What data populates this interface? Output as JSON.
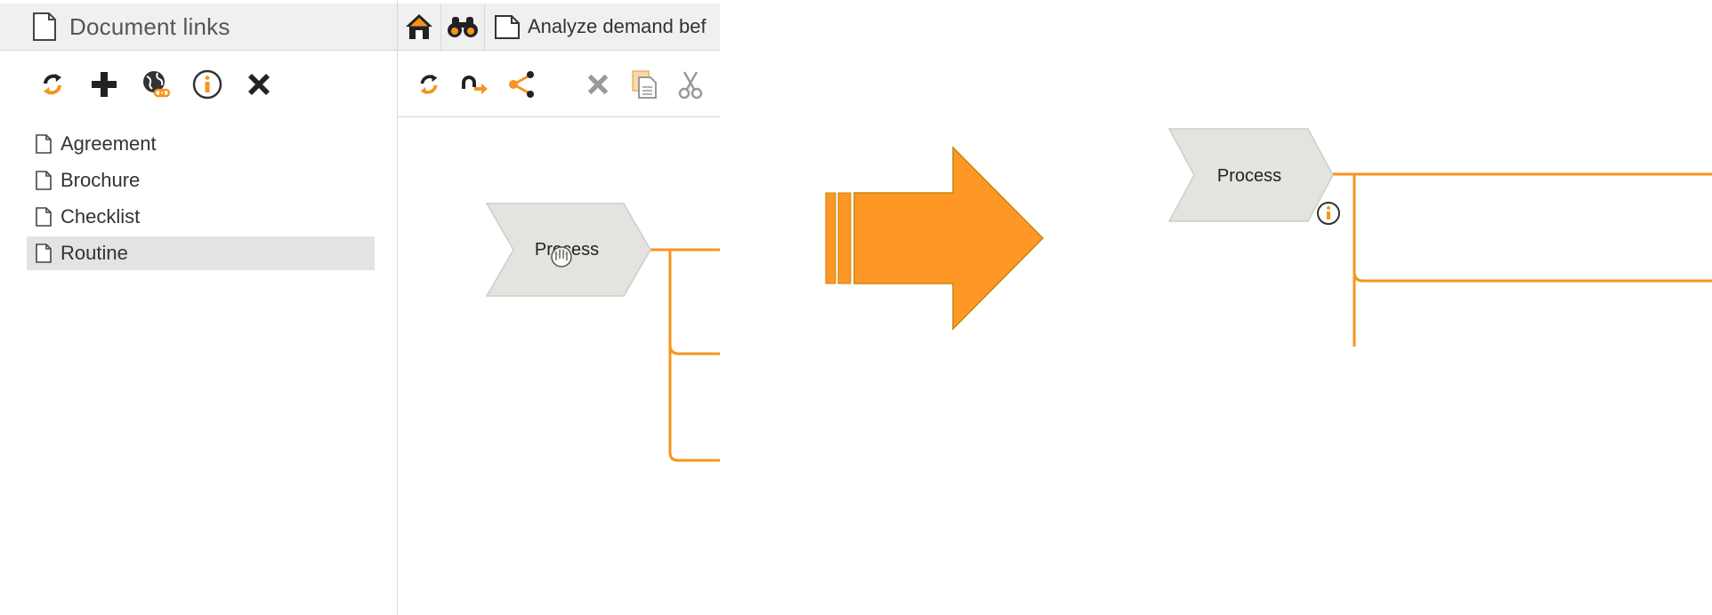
{
  "left_panel": {
    "title": "Document links",
    "toolbar": [
      "refresh-icon",
      "add-icon",
      "web-link-icon",
      "info-icon",
      "delete-icon"
    ],
    "documents": [
      {
        "label": "Agreement",
        "selected": false
      },
      {
        "label": "Brochure",
        "selected": false
      },
      {
        "label": "Checklist",
        "selected": false
      },
      {
        "label": "Routine",
        "selected": true
      }
    ]
  },
  "editor": {
    "tab_label": "Analyze demand bef",
    "toolbar": [
      "refresh-icon",
      "redo-icon",
      "share-icon",
      "delete-icon",
      "copy-icon",
      "cut-icon"
    ],
    "shape_label": "Process"
  },
  "result": {
    "shape_label": "Process"
  },
  "colors": {
    "accent": "#f7941d",
    "arrow": "#ff9726",
    "arrow_border": "#c8870a",
    "shape_fill": "#e4e3df",
    "shape_stroke": "#cfcdc7"
  }
}
